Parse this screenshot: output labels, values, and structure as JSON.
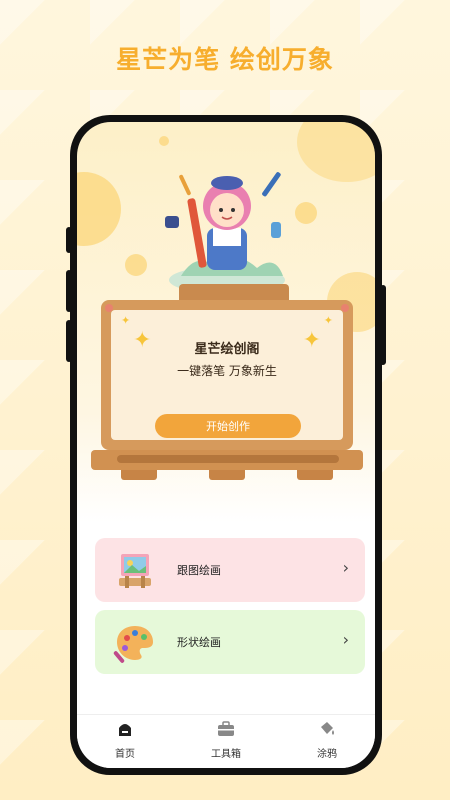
{
  "banner": {
    "title": "星芒为笔 绘创万象"
  },
  "board": {
    "title": "星芒绘创阁",
    "subtitle": "一键落笔 万象新生",
    "start_button": "开始创作"
  },
  "cards": [
    {
      "label": "跟图绘画",
      "icon": "easel-painting-icon"
    },
    {
      "label": "形状绘画",
      "icon": "palette-icon"
    }
  ],
  "tabbar": {
    "items": [
      {
        "label": "首页",
        "icon": "home-icon",
        "active": true
      },
      {
        "label": "工具箱",
        "icon": "toolbox-icon",
        "active": false
      },
      {
        "label": "涂鸦",
        "icon": "paint-bucket-icon",
        "active": false
      }
    ]
  },
  "colors": {
    "accent": "#f2a53b",
    "banner_text": "#f7ae2e",
    "card_pink": "#fde3e5",
    "card_green": "#e6f9d9"
  }
}
